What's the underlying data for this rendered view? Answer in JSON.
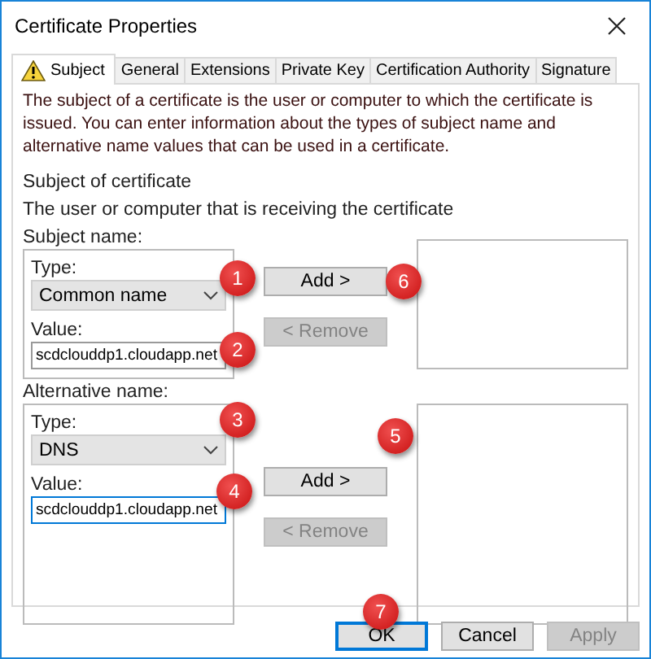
{
  "window": {
    "title": "Certificate Properties"
  },
  "tabs": [
    {
      "label": "Subject",
      "selected": true,
      "warning": true
    },
    {
      "label": "General",
      "selected": false,
      "warning": false
    },
    {
      "label": "Extensions",
      "selected": false,
      "warning": false
    },
    {
      "label": "Private Key",
      "selected": false,
      "warning": false
    },
    {
      "label": "Certification Authority",
      "selected": false,
      "warning": false
    },
    {
      "label": "Signature",
      "selected": false,
      "warning": false
    }
  ],
  "description": "The subject of a certificate is the user or computer to which the certificate is issued. You can enter information about the types of subject name and alternative name values that can be used in a certificate.",
  "section_title": "Subject of certificate",
  "section_subtitle": "The user or computer that is receiving the certificate",
  "groups": [
    {
      "heading": "Subject name:",
      "type_field": {
        "label": "Type:",
        "value": "Common name",
        "marker": "1"
      },
      "value_field": {
        "label": "Value:",
        "value": "scdclouddp1.cloudapp.net",
        "focused": false,
        "marker": "2"
      },
      "add": {
        "label": "Add >",
        "disabled": false,
        "marker": "6"
      },
      "remove": {
        "label": "< Remove",
        "disabled": true
      }
    },
    {
      "heading": "Alternative name:",
      "type_field": {
        "label": "Type:",
        "value": "DNS",
        "marker": "3"
      },
      "value_field": {
        "label": "Value:",
        "value": "scdclouddp1.cloudapp.net",
        "focused": true,
        "marker": "4"
      },
      "add": {
        "label": "Add >",
        "disabled": false,
        "marker": "5"
      },
      "remove": {
        "label": "< Remove",
        "disabled": true
      }
    }
  ],
  "buttons": [
    {
      "label": "OK",
      "default": true,
      "disabled": false,
      "marker": "7"
    },
    {
      "label": "Cancel",
      "default": false,
      "disabled": false
    },
    {
      "label": "Apply",
      "default": false,
      "disabled": true
    }
  ]
}
